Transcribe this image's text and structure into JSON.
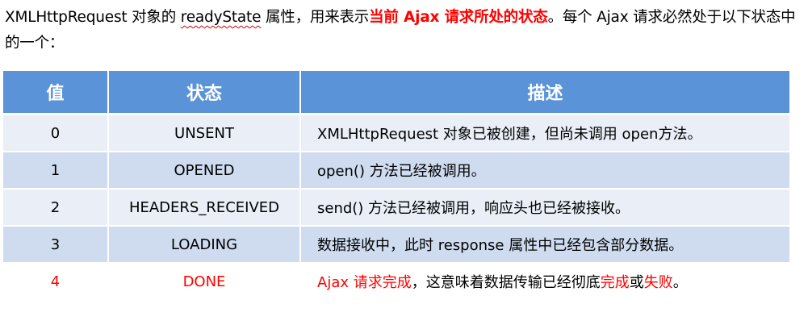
{
  "intro": {
    "part1": "XMLHttpRequest 对象的 ",
    "readyState": "readyState",
    "part2": " 属性，用来表示",
    "highlight": "当前 Ajax 请求所处的状态",
    "part3": "。每个 Ajax 请求必然处于以下状态中的一个："
  },
  "table": {
    "headers": [
      "值",
      "状态",
      "描述"
    ],
    "rows": [
      {
        "value": "0",
        "state": "UNSENT",
        "desc": "XMLHttpRequest 对象已被创建，但尚未调用 open方法。"
      },
      {
        "value": "1",
        "state": "OPENED",
        "desc": "open() 方法已经被调用。"
      },
      {
        "value": "2",
        "state": "HEADERS_RECEIVED",
        "desc": "send() 方法已经被调用，响应头也已经被接收。"
      },
      {
        "value": "3",
        "state": "LOADING",
        "desc": "数据接收中，此时 response 属性中已经包含部分数据。"
      },
      {
        "value": "4",
        "state": "DONE",
        "desc_parts": [
          "Ajax 请求完成",
          "，这意味着数据传输已经彻底",
          "完成",
          "或",
          "失败",
          "。"
        ]
      }
    ]
  },
  "colors": {
    "header_bg": "#5b93d8",
    "row_light": "#e9eef7",
    "row_dark": "#cfdcf0",
    "highlight": "#ff0000"
  }
}
